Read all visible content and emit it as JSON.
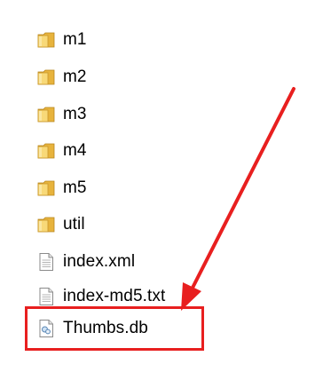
{
  "files": [
    {
      "name": "m1",
      "type": "folder"
    },
    {
      "name": "m2",
      "type": "folder"
    },
    {
      "name": "m3",
      "type": "folder"
    },
    {
      "name": "m4",
      "type": "folder"
    },
    {
      "name": "m5",
      "type": "folder"
    },
    {
      "name": "util",
      "type": "folder"
    },
    {
      "name": "index.xml",
      "type": "document"
    },
    {
      "name": "index-md5.txt",
      "type": "document"
    },
    {
      "name": "Thumbs.db",
      "type": "system-file"
    }
  ],
  "icons": {
    "folder": "folder-icon",
    "document": "document-icon",
    "system-file": "thumbs-db-icon"
  },
  "colors": {
    "annotation_red": "#e81f1f",
    "folder_yellow": "#f3c84b",
    "text": "#000000"
  }
}
